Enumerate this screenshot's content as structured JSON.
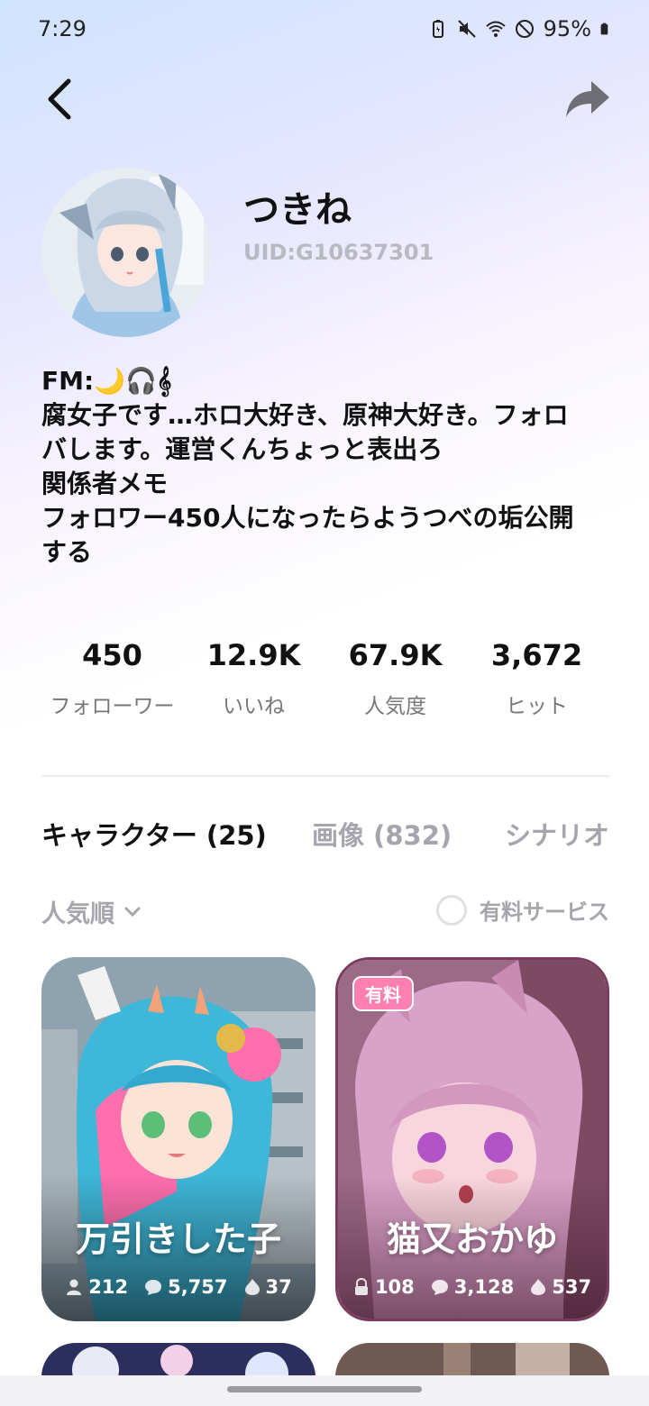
{
  "status_bar": {
    "time": "7:29",
    "battery": "95%"
  },
  "profile": {
    "name": "つきね",
    "uid": "UID:G10637301"
  },
  "bio": [
    "FM:🌙🎧𝄞",
    "腐女子です…ホロ大好き、原神大好き。フォロ",
    "バします。運営くんちょっと表出ろ",
    "関係者メモ",
    "フォロワー450人になったらようつべの垢公開",
    "する"
  ],
  "stats": [
    {
      "value": "450",
      "label": "フォローワー"
    },
    {
      "value": "12.9K",
      "label": "いいね"
    },
    {
      "value": "67.9K",
      "label": "人気度"
    },
    {
      "value": "3,672",
      "label": "ヒット"
    }
  ],
  "tabs": [
    {
      "label": "キャラクター (25)",
      "active": true
    },
    {
      "label": "画像 (832)",
      "active": false
    },
    {
      "label": "シナリオ",
      "active": false
    }
  ],
  "sort": {
    "label": "人気順",
    "paid_filter_label": "有料サービス"
  },
  "cards": [
    {
      "title": "万引きした子",
      "stat1": "212",
      "stat2": "5,757",
      "stat3": "37",
      "paid": false
    },
    {
      "title": "猫又おかゆ",
      "stat1": "108",
      "stat2": "3,128",
      "stat3": "537",
      "paid": true,
      "badge": "有料"
    }
  ],
  "colors": {
    "accent_paid": "#ff7fb0",
    "card_border": "#7a3b5e"
  }
}
